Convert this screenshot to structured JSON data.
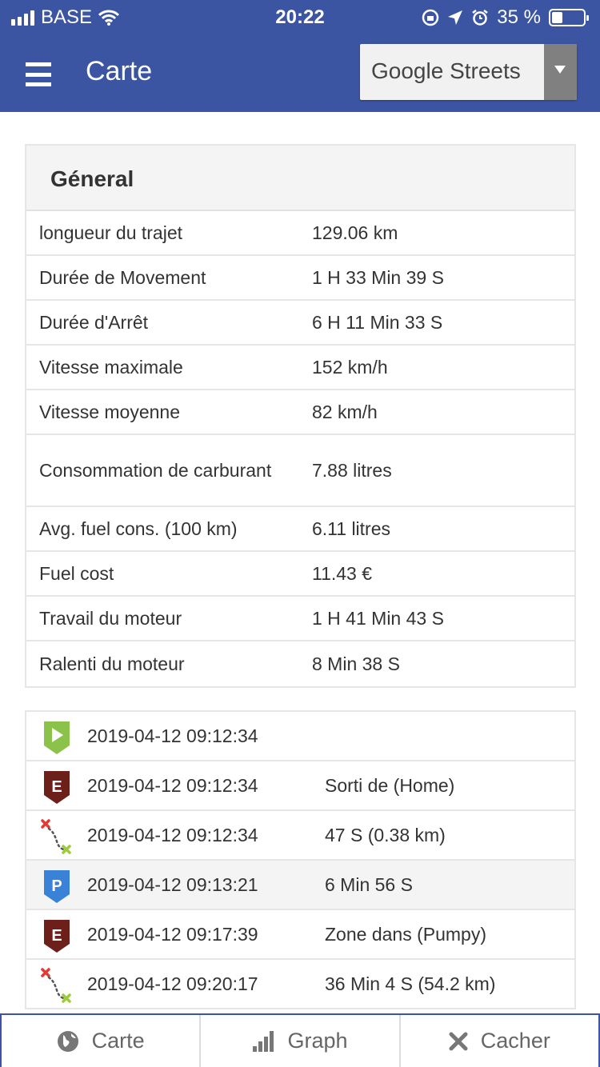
{
  "status_bar": {
    "carrier": "BASE",
    "time": "20:22",
    "battery": "35 %",
    "battery_level": 0.35
  },
  "header": {
    "title": "Carte",
    "layer_select": "Google Streets"
  },
  "general": {
    "heading": "Géneral",
    "rows": [
      {
        "label": "longueur du trajet",
        "value": "129.06 km"
      },
      {
        "label": "Durée de Movement",
        "value": "1 H 33 Min 39 S"
      },
      {
        "label": "Durée d'Arrêt",
        "value": "6 H 11 Min 33 S"
      },
      {
        "label": "Vitesse maximale",
        "value": "152 km/h"
      },
      {
        "label": "Vitesse moyenne",
        "value": "82 km/h"
      },
      {
        "label": "Consommation de carburant",
        "value": "7.88 litres"
      },
      {
        "label": "Avg. fuel cons. (100 km)",
        "value": "6.11 litres"
      },
      {
        "label": "Fuel cost",
        "value": "11.43 €"
      },
      {
        "label": "Travail du moteur",
        "value": "1 H 41 Min 43 S"
      },
      {
        "label": "Ralenti du moteur",
        "value": "8 Min 38 S"
      }
    ]
  },
  "events": [
    {
      "icon": "start-flag-icon",
      "time": "2019-04-12 09:12:34",
      "info": ""
    },
    {
      "icon": "zone-exit-icon",
      "time": "2019-04-12 09:12:34",
      "info": "Sorti de (Home)",
      "letter": "E"
    },
    {
      "icon": "route-icon",
      "time": "2019-04-12 09:12:34",
      "info": "47 S (0.38 km)"
    },
    {
      "icon": "parking-icon",
      "time": "2019-04-12 09:13:21",
      "info": "6 Min 56 S",
      "letter": "P"
    },
    {
      "icon": "zone-enter-icon",
      "time": "2019-04-12 09:17:39",
      "info": "Zone dans (Pumpy)",
      "letter": "E"
    },
    {
      "icon": "route-icon",
      "time": "2019-04-12 09:20:17",
      "info": "36 Min 4 S (54.2 km)"
    }
  ],
  "tabs": [
    {
      "label": "Carte",
      "icon": "globe-icon"
    },
    {
      "label": "Graph",
      "icon": "bar-chart-icon"
    },
    {
      "label": "Cacher",
      "icon": "close-icon"
    }
  ],
  "colors": {
    "header_bg": "#3b55a2",
    "start_green": "#8bc34a",
    "zone_brown": "#6d1f1a",
    "parking_blue": "#3a82d8"
  }
}
